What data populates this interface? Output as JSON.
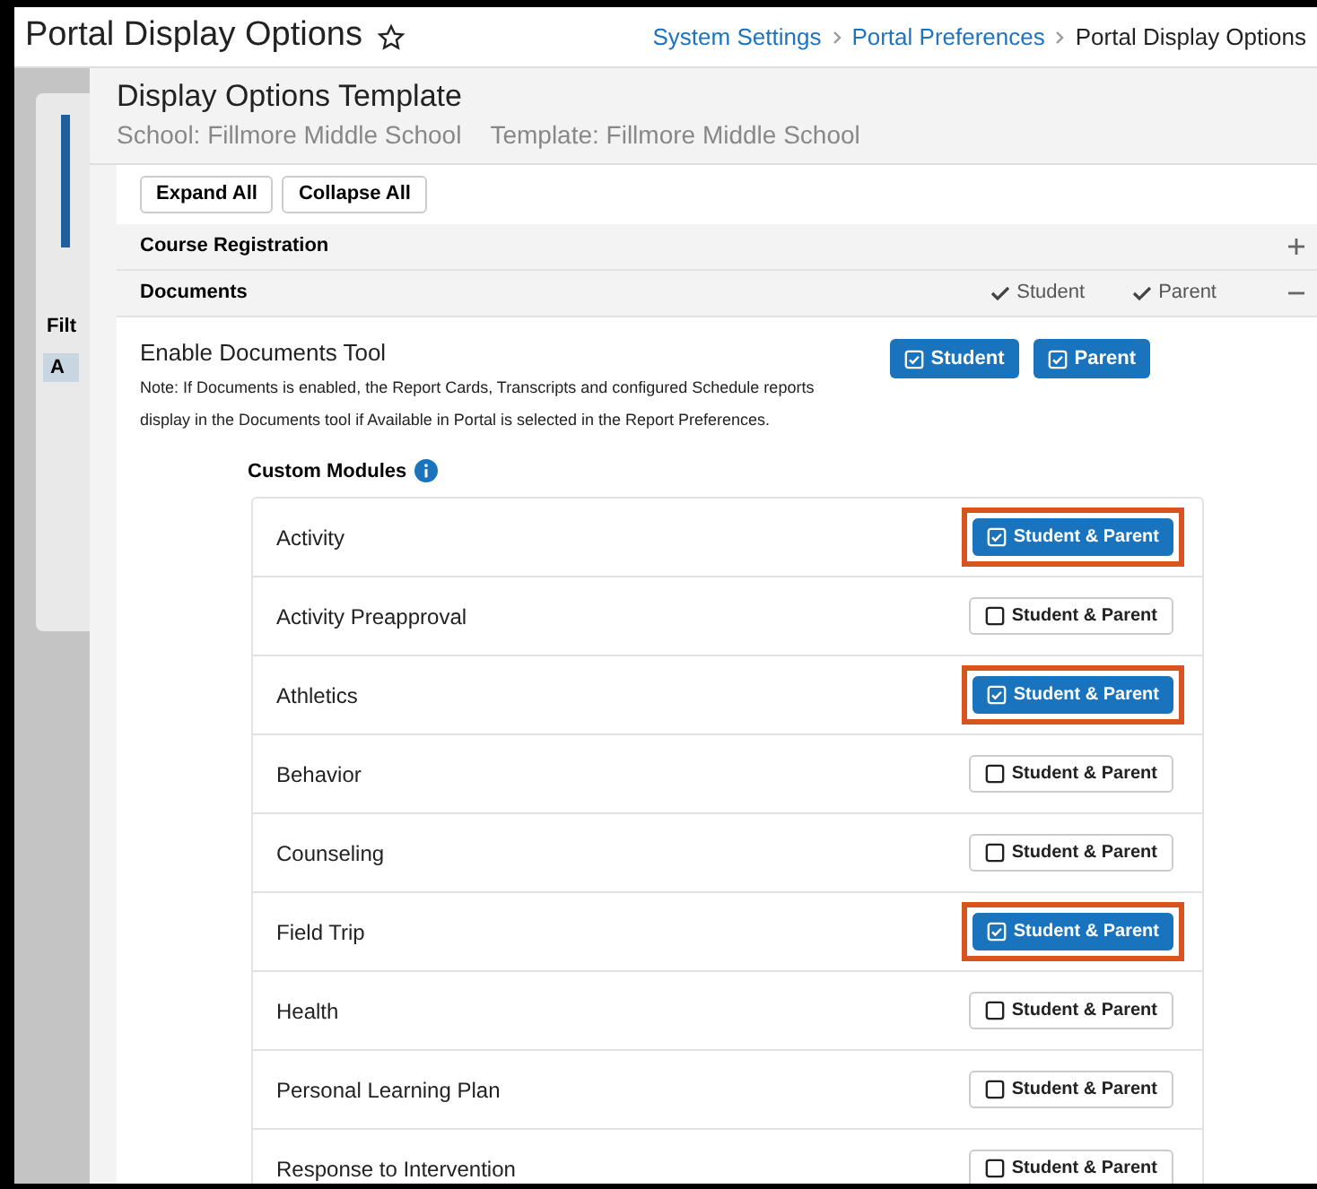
{
  "header": {
    "title": "Portal Display Options",
    "breadcrumbs": [
      {
        "label": "System Settings",
        "link": true
      },
      {
        "label": "Portal Preferences",
        "link": true
      },
      {
        "label": "Portal Display Options",
        "link": false
      }
    ]
  },
  "background_panel": {
    "filter_label": "Filt",
    "chip": "A"
  },
  "template": {
    "title": "Display Options Template",
    "school": "School: Fillmore Middle School",
    "template": "Template: Fillmore Middle School"
  },
  "toolbar": [
    "Expand All",
    "Collapse All"
  ],
  "sections": [
    {
      "title": "Course Registration",
      "expanded": false
    },
    {
      "title": "Documents",
      "expanded": true,
      "audiences": [
        "Student",
        "Parent"
      ]
    }
  ],
  "documents_tool": {
    "title": "Enable Documents Tool",
    "note_1": "Note: If Documents is enabled, the Report Cards, Transcripts and configured Schedule reports",
    "note_2": "display in the Documents tool if Available in Portal is selected in the Report Preferences.",
    "toggles": [
      {
        "label": "Student",
        "checked": true
      },
      {
        "label": "Parent",
        "checked": true
      }
    ]
  },
  "custom_modules": {
    "title": "Custom Modules",
    "modules": [
      {
        "name": "Activity",
        "button": "Student & Parent",
        "checked": true
      },
      {
        "name": "Activity Preapproval",
        "button": "Student & Parent",
        "checked": false
      },
      {
        "name": "Athletics",
        "button": "Student & Parent",
        "checked": true
      },
      {
        "name": "Behavior",
        "button": "Student & Parent",
        "checked": false
      },
      {
        "name": "Counseling",
        "button": "Student & Parent",
        "checked": false
      },
      {
        "name": "Field Trip",
        "button": "Student & Parent",
        "checked": true
      },
      {
        "name": "Health",
        "button": "Student & Parent",
        "checked": false
      },
      {
        "name": "Personal Learning Plan",
        "button": "Student & Parent",
        "checked": false
      },
      {
        "name": "Response to Intervention",
        "button": "Student & Parent",
        "checked": false
      }
    ]
  }
}
